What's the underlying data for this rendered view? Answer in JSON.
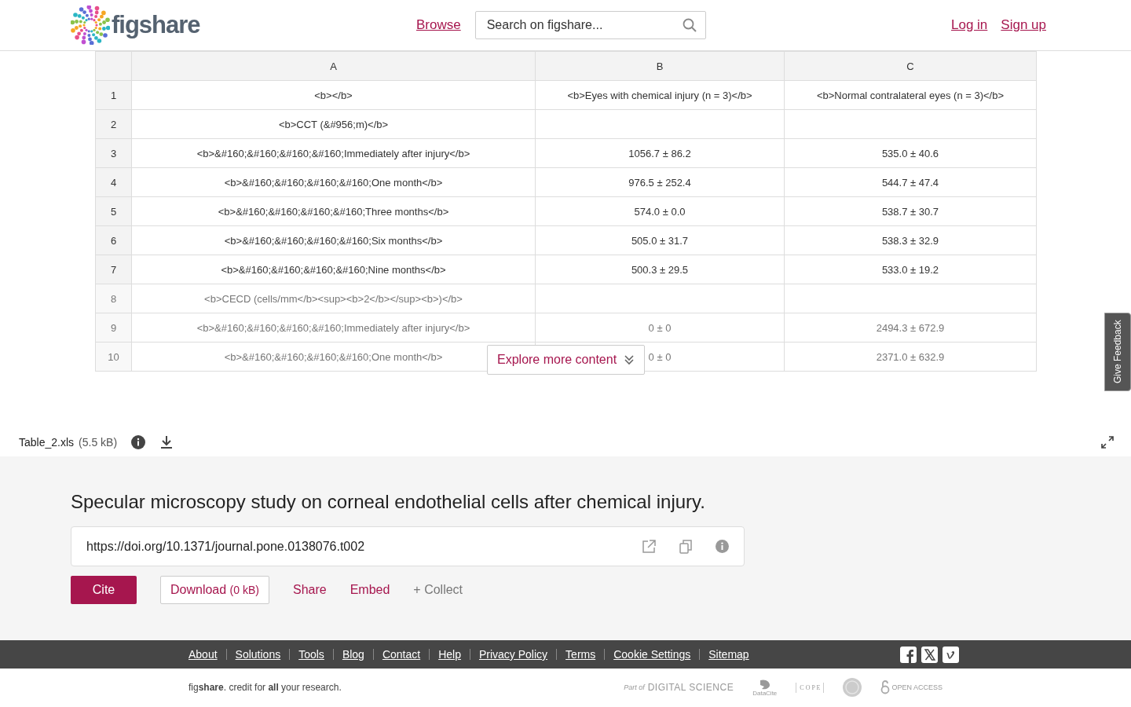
{
  "header": {
    "logo": "figshare",
    "nav_link": "Browse",
    "search": {
      "placeholder": "Search on figshare..."
    },
    "auth_links": [
      "Log in",
      "Sign up"
    ]
  },
  "table": {
    "columns": [
      "A",
      "B",
      "C"
    ],
    "rows": [
      {
        "number": "1",
        "cells": [
          "<b></b>",
          "<b>Eyes with chemical injury (n = 3)</b>",
          "<b>Normal contralateral eyes (n = 3)</b>"
        ],
        "faded": false
      },
      {
        "number": "2",
        "cells": [
          "<b>CCT (&#956;m)</b>",
          "",
          ""
        ],
        "faded": false
      },
      {
        "number": "3",
        "cells": [
          "<b>&#160;&#160;&#160;&#160;Immediately after injury</b>",
          "1056.7 ± 86.2",
          "535.0 ± 40.6"
        ],
        "faded": false
      },
      {
        "number": "4",
        "cells": [
          "<b>&#160;&#160;&#160;&#160;One month</b>",
          "976.5 ± 252.4",
          "544.7 ± 47.4"
        ],
        "faded": false
      },
      {
        "number": "5",
        "cells": [
          "<b>&#160;&#160;&#160;&#160;Three months</b>",
          "574.0 ± 0.0",
          "538.7 ± 30.7"
        ],
        "faded": false
      },
      {
        "number": "6",
        "cells": [
          "<b>&#160;&#160;&#160;&#160;Six months</b>",
          "505.0 ± 31.7",
          "538.3 ± 32.9"
        ],
        "faded": false
      },
      {
        "number": "7",
        "cells": [
          "<b>&#160;&#160;&#160;&#160;Nine months</b>",
          "500.3 ± 29.5",
          "533.0 ± 19.2"
        ],
        "faded": false
      },
      {
        "number": "8",
        "cells": [
          "<b>CECD (cells/mm</b><sup><b>2</b></sup><b>)</b>",
          "",
          ""
        ],
        "faded": true
      },
      {
        "number": "9",
        "cells": [
          "<b>&#160;&#160;&#160;&#160;Immediately after injury</b>",
          "0 ± 0",
          "2494.3 ± 672.9"
        ],
        "faded": true
      },
      {
        "number": "10",
        "cells": [
          "<b>&#160;&#160;&#160;&#160;One month</b>",
          "0 ± 0",
          "2371.0 ± 632.9"
        ],
        "faded": true
      }
    ]
  },
  "explore_button": "Explore more content",
  "feedback_tab": "Give Feedback",
  "file": {
    "name": "Table_2.xls",
    "size": "(5.5 kB)"
  },
  "title": "Specular microscopy study on corneal endothelial cells after chemical injury.",
  "doi": "https://doi.org/10.1371/journal.pone.0138076.t002",
  "actions": [
    {
      "kind": "primary",
      "label": "Cite"
    },
    {
      "kind": "outlined",
      "label": "Download",
      "note": "(0 kB)"
    },
    {
      "kind": "link",
      "label": "Share"
    },
    {
      "kind": "link",
      "label": "Embed"
    },
    {
      "kind": "muted",
      "label": "+ Collect"
    }
  ],
  "footer": {
    "links": [
      "About",
      "Solutions",
      "Tools",
      "Blog",
      "Contact",
      "Help",
      "Privacy Policy",
      "Terms",
      "Cookie Settings",
      "Sitemap"
    ],
    "tagline": "fig**share**. credit for **all** your research.",
    "partner_logos": [
      {
        "kind": "digital-science",
        "prefix": "Part of",
        "text": "DIGITAL SCIENCE"
      },
      {
        "kind": "datacite",
        "text": "DataCite"
      },
      {
        "kind": "cope",
        "text": "C O P E"
      },
      {
        "kind": "seal"
      },
      {
        "kind": "open-access",
        "text": "OPEN ACCESS"
      }
    ]
  }
}
